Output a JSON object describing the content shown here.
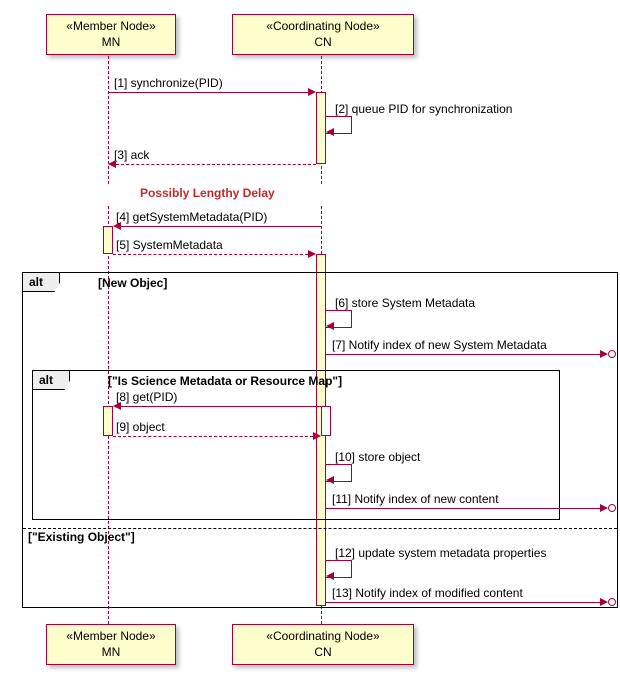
{
  "participants": {
    "mn": {
      "stereotype": "«Member Node»",
      "name": "MN"
    },
    "cn": {
      "stereotype": "«Coordinating Node»",
      "name": "CN"
    }
  },
  "delay": "Possibly Lengthy Delay",
  "messages": {
    "m1": "[1]  synchronize(PID)",
    "m2": "[2]  queue PID for synchronization",
    "m3": "[3]  ack",
    "m4": "[4]  getSystemMetadata(PID)",
    "m5": "[5]  SystemMetadata",
    "m6": "[6]  store System Metadata",
    "m7": "[7]  Notify index of new System Metadata",
    "m8": "[8]  get(PID)",
    "m9": "[9]  object",
    "m10": "[10]  store object",
    "m11": "[11]  Notify index of new content",
    "m12": "[12]  update system metadata properties",
    "m13": "[13]  Notify index of modified content"
  },
  "fragments": {
    "alt_outer": {
      "label": "alt",
      "guard1": "[New Objec]",
      "guard2": "[\"Existing Object\"]"
    },
    "alt_inner": {
      "label": "alt",
      "guard1": "[\"Is Science Metadata or Resource Map\"]"
    }
  },
  "chart_data": {
    "type": "sequence-diagram",
    "participants": [
      {
        "id": "MN",
        "stereotype": "Member Node"
      },
      {
        "id": "CN",
        "stereotype": "Coordinating Node"
      }
    ],
    "interactions": [
      {
        "seq": 1,
        "from": "MN",
        "to": "CN",
        "label": "synchronize(PID)"
      },
      {
        "seq": 2,
        "from": "CN",
        "to": "CN",
        "label": "queue PID for synchronization"
      },
      {
        "seq": 3,
        "from": "CN",
        "to": "MN",
        "label": "ack"
      },
      {
        "type": "delay",
        "label": "Possibly Lengthy Delay"
      },
      {
        "seq": 4,
        "from": "CN",
        "to": "MN",
        "label": "getSystemMetadata(PID)"
      },
      {
        "seq": 5,
        "from": "MN",
        "to": "CN",
        "label": "SystemMetadata"
      },
      {
        "type": "alt",
        "guard": "New Objec",
        "children": [
          {
            "seq": 6,
            "from": "CN",
            "to": "CN",
            "label": "store System Metadata"
          },
          {
            "seq": 7,
            "from": "CN",
            "to": "out",
            "label": "Notify index of new System Metadata"
          },
          {
            "type": "alt",
            "guard": "Is Science Metadata or Resource Map",
            "children": [
              {
                "seq": 8,
                "from": "CN",
                "to": "MN",
                "label": "get(PID)"
              },
              {
                "seq": 9,
                "from": "MN",
                "to": "CN",
                "label": "object"
              },
              {
                "seq": 10,
                "from": "CN",
                "to": "CN",
                "label": "store object"
              },
              {
                "seq": 11,
                "from": "CN",
                "to": "out",
                "label": "Notify index of new content"
              }
            ]
          }
        ],
        "else": {
          "guard": "Existing Object",
          "children": [
            {
              "seq": 12,
              "from": "CN",
              "to": "CN",
              "label": "update system metadata properties"
            },
            {
              "seq": 13,
              "from": "CN",
              "to": "out",
              "label": "Notify index of modified content"
            }
          ]
        }
      }
    ]
  }
}
